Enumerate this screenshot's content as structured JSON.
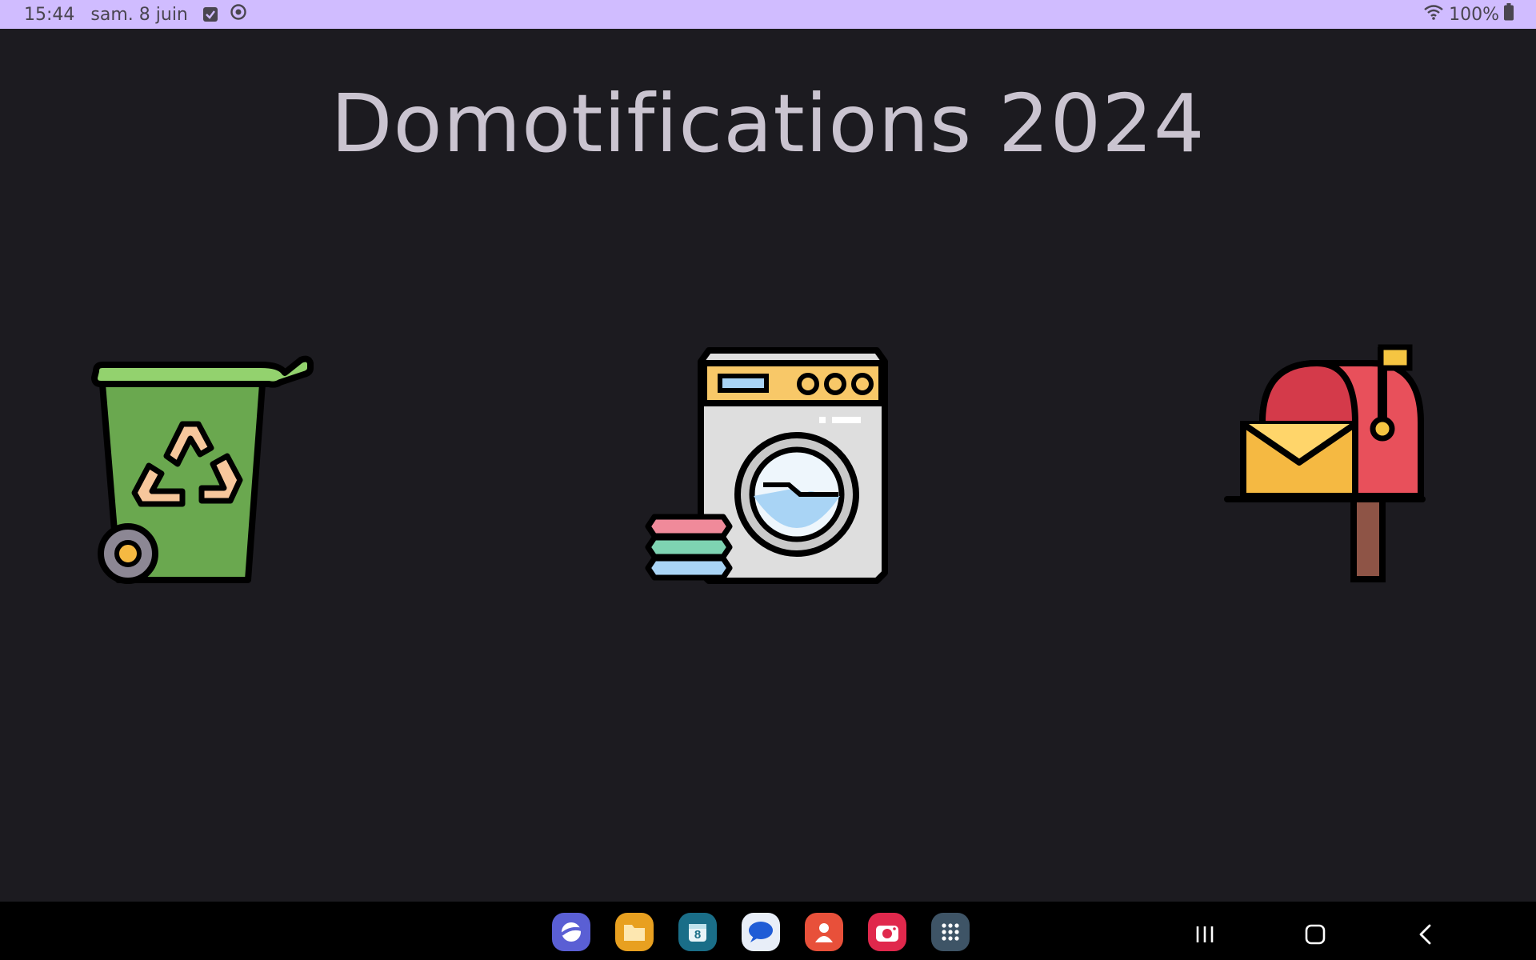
{
  "status_bar": {
    "time": "15:44",
    "date": "sam. 8 juin",
    "battery": "100%",
    "icons": [
      "checkbox-icon",
      "sync-icon",
      "wifi-icon",
      "battery-icon"
    ]
  },
  "main": {
    "title": "Domotifications 2024",
    "tiles": [
      {
        "name": "recycling-bin",
        "icon": "recycle-bin-icon"
      },
      {
        "name": "washing-machine",
        "icon": "washing-machine-icon"
      },
      {
        "name": "mailbox",
        "icon": "mailbox-icon"
      }
    ]
  },
  "dock": {
    "apps": [
      {
        "icon": "internet-icon",
        "color": "#5a5fd4"
      },
      {
        "icon": "files-icon",
        "color": "#e8a020"
      },
      {
        "icon": "calendar-icon",
        "color": "#1a6e88",
        "label": "8"
      },
      {
        "icon": "messages-icon",
        "color": "#e8eef8"
      },
      {
        "icon": "contacts-icon",
        "color": "#e8503a"
      },
      {
        "icon": "camera-icon",
        "color": "#e0284c"
      },
      {
        "icon": "app-drawer-icon",
        "color": "#3e5466"
      }
    ]
  },
  "navigation": {
    "buttons": [
      "recents-button",
      "home-button",
      "back-button"
    ]
  },
  "colors": {
    "background": "#1c1b20",
    "status_bar": "#d0bcff",
    "title_text": "#cac4d0"
  }
}
